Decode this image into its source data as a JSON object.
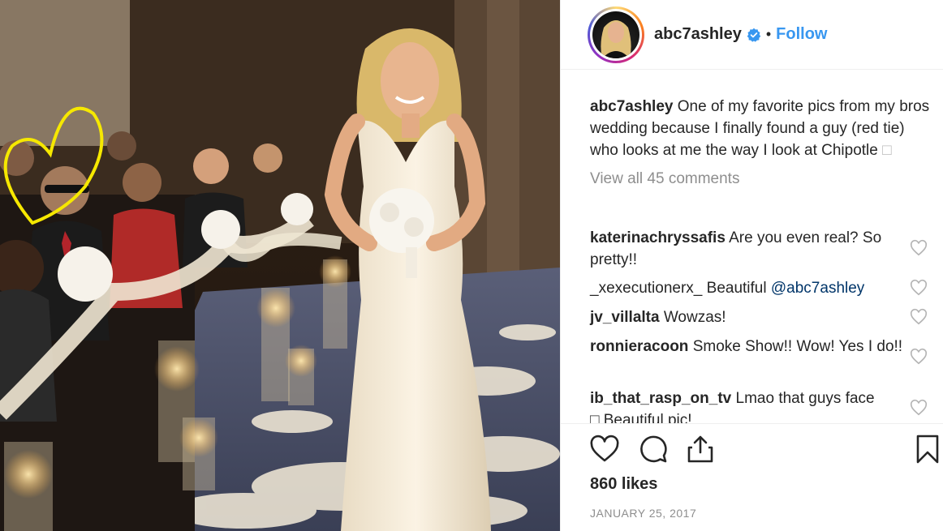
{
  "post": {
    "username": "abc7ashley",
    "follow_label": "Follow",
    "separator": "•",
    "caption_user": "abc7ashley",
    "caption_text": "One of my favorite pics from my bros wedding because I finally found a guy (red tie) who looks at me the way I look at Chipotle",
    "caption_emoji": "□",
    "view_all": "View all 45 comments",
    "comments": [
      {
        "user": "katerinachryssafis",
        "text": "Are you even real? So pretty!!",
        "mention": ""
      },
      {
        "user": "_xexecutionerx_",
        "text": "Beautiful",
        "mention": "@abc7ashley"
      },
      {
        "user": "jv_villalta",
        "text": "Wowzas!",
        "mention": ""
      },
      {
        "user": "ronnieracoon",
        "text": "Smoke Show!! Wow! Yes I do!!",
        "mention": ""
      },
      {
        "user": "ib_that_rasp_on_tv",
        "text": "Lmao that guys face",
        "mention": ""
      }
    ],
    "comment5_line2": "□ Beautiful pic!",
    "likes": "860 likes",
    "date": "JANUARY 25, 2017"
  },
  "colors": {
    "link": "#3897f0",
    "mention": "#003569",
    "muted": "#8e8e8e",
    "text": "#262626"
  },
  "icons": {
    "like": "heart-icon",
    "comment": "comment-bubble-icon",
    "share": "share-icon",
    "save": "bookmark-icon",
    "verified": "verified-badge-icon"
  }
}
